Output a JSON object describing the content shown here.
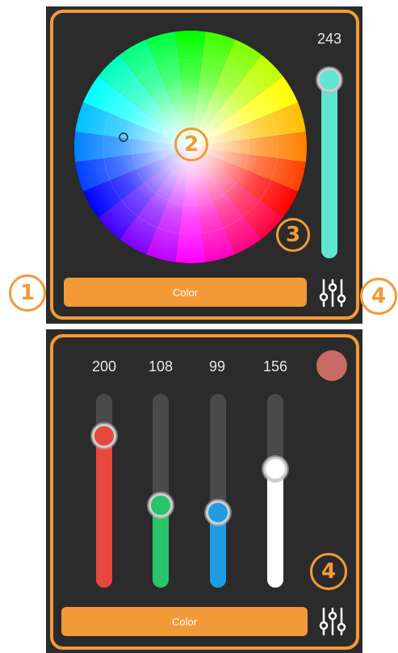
{
  "top_panel": {
    "brightness_value": "243",
    "brightness_level": 243,
    "brightness_max": 255,
    "slider_color": "#5ee6d0",
    "button_label": "Color",
    "picker_marker_color": "#6ff0e0"
  },
  "bottom_panel": {
    "channels": [
      {
        "name": "red",
        "value": "200",
        "level": 200,
        "color": "#e8473d"
      },
      {
        "name": "green",
        "value": "108",
        "level": 108,
        "color": "#28c469"
      },
      {
        "name": "blue",
        "value": "99",
        "level": 99,
        "color": "#1f9de0"
      },
      {
        "name": "white",
        "value": "156",
        "level": 156,
        "color": "#ffffff"
      }
    ],
    "swatch_color": "#c86c63",
    "button_label": "Color",
    "max": 255
  },
  "badges": {
    "b1": "1",
    "b2": "2",
    "b3": "3",
    "b4_top": "4",
    "b4_bottom": "4"
  },
  "icons": {
    "sliders": "sliders-icon"
  },
  "accent_color": "#f39a38"
}
